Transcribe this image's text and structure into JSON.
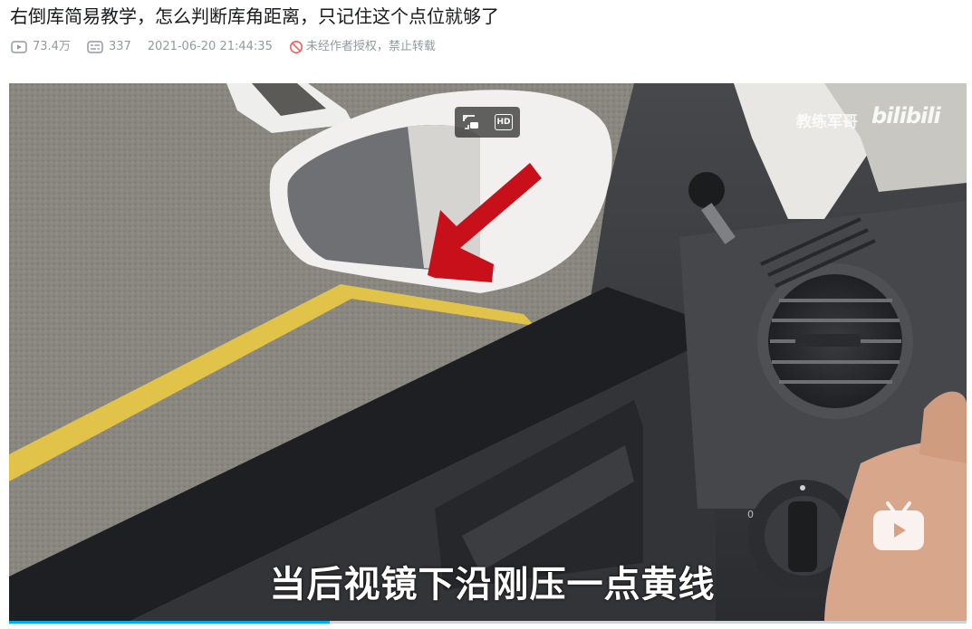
{
  "video": {
    "title": "右倒库简易教学，怎么判断库角距离，只记住这个点位就够了",
    "views": "73.4万",
    "danmaku": "337",
    "date": "2021-06-20 21:44:35",
    "copyright_notice": "未经作者授权，禁止转载"
  },
  "player": {
    "subtitle": "当后视镜下沿刚压一点黄线",
    "watermark_author": "教练军哥",
    "watermark_brand": "bilibili",
    "hd_label": "HD",
    "progress_fraction": 0.335
  },
  "icons": {
    "views": "play-count-icon",
    "danmaku": "danmaku-icon",
    "copyright": "no-reprint-icon",
    "miniplayer": "mini-player-icon",
    "logo": "bilibili-tv-icon"
  },
  "colors": {
    "accent": "#00aeec",
    "meta_gray": "#9499a0",
    "no_reprint_red": "#f25d59",
    "lane_yellow": "#e2c34a",
    "arrow_red": "#c8101a"
  }
}
